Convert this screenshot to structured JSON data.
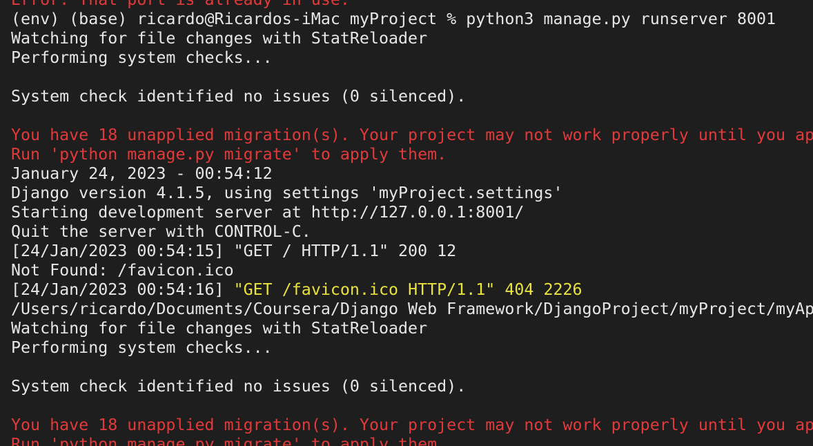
{
  "colors": {
    "background": "#1e1e1e",
    "text": "#e6e6e6",
    "error": "#e23a3a",
    "highlight": "#e9e23b"
  },
  "lines": [
    {
      "type": "red",
      "text": "Error: That port is already in use."
    },
    {
      "type": "normal",
      "text": "(env) (base) ricardo@Ricardos-iMac myProject % python3 manage.py runserver 8001"
    },
    {
      "type": "normal",
      "text": "Watching for file changes with StatReloader"
    },
    {
      "type": "normal",
      "text": "Performing system checks..."
    },
    {
      "type": "blank",
      "text": ""
    },
    {
      "type": "normal",
      "text": "System check identified no issues (0 silenced)."
    },
    {
      "type": "blank",
      "text": ""
    },
    {
      "type": "red",
      "text": "You have 18 unapplied migration(s). Your project may not work properly until you ap"
    },
    {
      "type": "red",
      "text": "Run 'python manage.py migrate' to apply them."
    },
    {
      "type": "normal",
      "text": "January 24, 2023 - 00:54:12"
    },
    {
      "type": "normal",
      "text": "Django version 4.1.5, using settings 'myProject.settings'"
    },
    {
      "type": "normal",
      "text": "Starting development server at http://127.0.0.1:8001/"
    },
    {
      "type": "normal",
      "text": "Quit the server with CONTROL-C."
    },
    {
      "type": "normal",
      "text": "[24/Jan/2023 00:54:15] \"GET / HTTP/1.1\" 200 12"
    },
    {
      "type": "normal",
      "text": "Not Found: /favicon.ico"
    },
    {
      "type": "mixed",
      "prefix": "[24/Jan/2023 00:54:16] ",
      "highlight": "\"GET /favicon.ico HTTP/1.1\" 404 2226"
    },
    {
      "type": "normal",
      "text": "/Users/ricardo/Documents/Coursera/Django Web Framework/DjangoProject/myProject/myAp"
    },
    {
      "type": "normal",
      "text": "Watching for file changes with StatReloader"
    },
    {
      "type": "normal",
      "text": "Performing system checks..."
    },
    {
      "type": "blank",
      "text": ""
    },
    {
      "type": "normal",
      "text": "System check identified no issues (0 silenced)."
    },
    {
      "type": "blank",
      "text": ""
    },
    {
      "type": "red",
      "text": "You have 18 unapplied migration(s). Your project may not work properly until you ap"
    },
    {
      "type": "red",
      "text": "Run 'python manage.py migrate' to apply them."
    }
  ]
}
